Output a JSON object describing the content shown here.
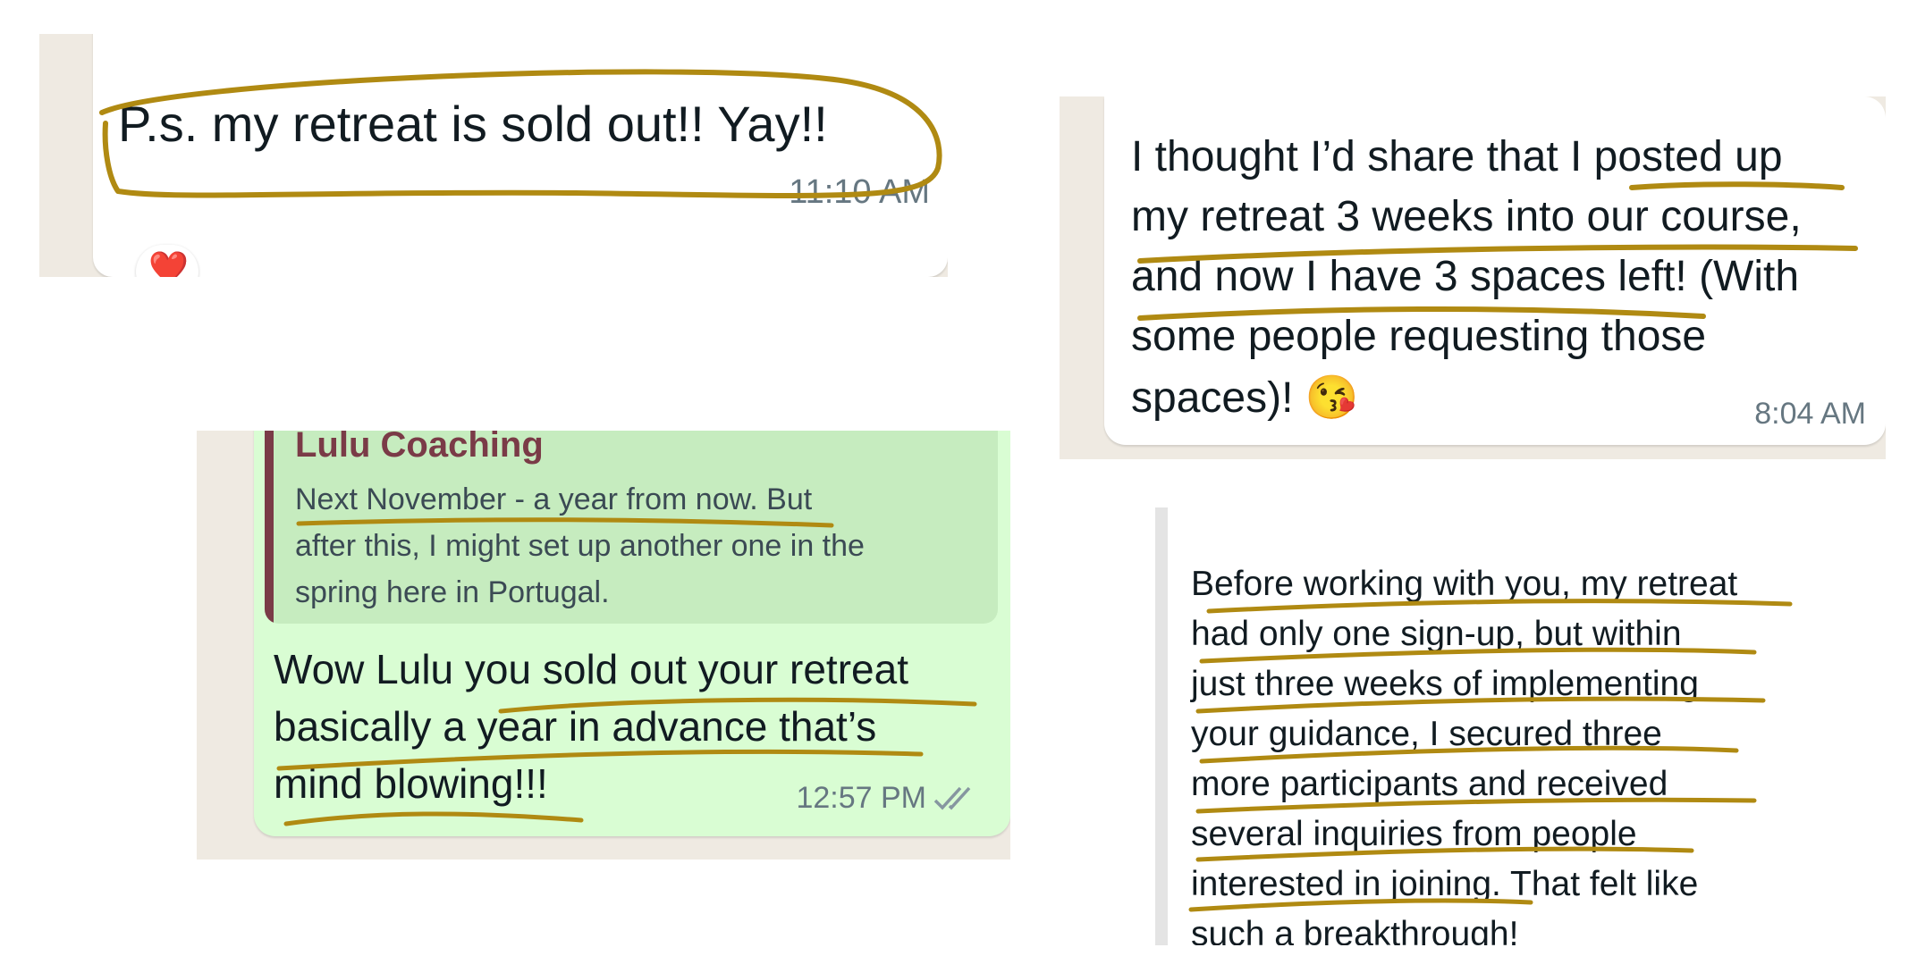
{
  "panel_1": {
    "message": "P.s. my retreat is sold out!! Yay!!",
    "time": "11:10 AM",
    "reaction": "❤️"
  },
  "panel_2": {
    "lines": [
      "I thought I’d share that I posted up",
      "my retreat 3 weeks into our course,",
      "and now I have 3 spaces left! (With",
      "some people requesting those",
      "spaces)! 😘"
    ],
    "time": "8:04 AM"
  },
  "panel_3": {
    "quote_author": "Lulu Coaching",
    "quote_lines": [
      "Next November - a year from now. But",
      "after this, I might set up another one in the",
      "spring here in Portugal."
    ],
    "lines": [
      "Wow Lulu you sold out your retreat",
      "basically a year in advance that’s",
      "mind blowing!!!"
    ],
    "time": "12:57 PM",
    "status_icon": "double-check-icon"
  },
  "panel_4": {
    "lines": [
      "Before working with you, my retreat",
      "had only one sign-up, but within",
      "just three weeks of implementing",
      "your guidance, I secured three",
      "more participants and received",
      "several inquiries from people",
      "interested in joining. That felt like",
      "such a breakthrough!"
    ]
  },
  "colors": {
    "wallpaper": "#efeae2",
    "bubble_incoming": "#ffffff",
    "bubble_outgoing": "#d9fdd3",
    "quote_bar": "#7a3b47",
    "quote_author": "#7a3b47",
    "highlight": "#b08a12"
  }
}
